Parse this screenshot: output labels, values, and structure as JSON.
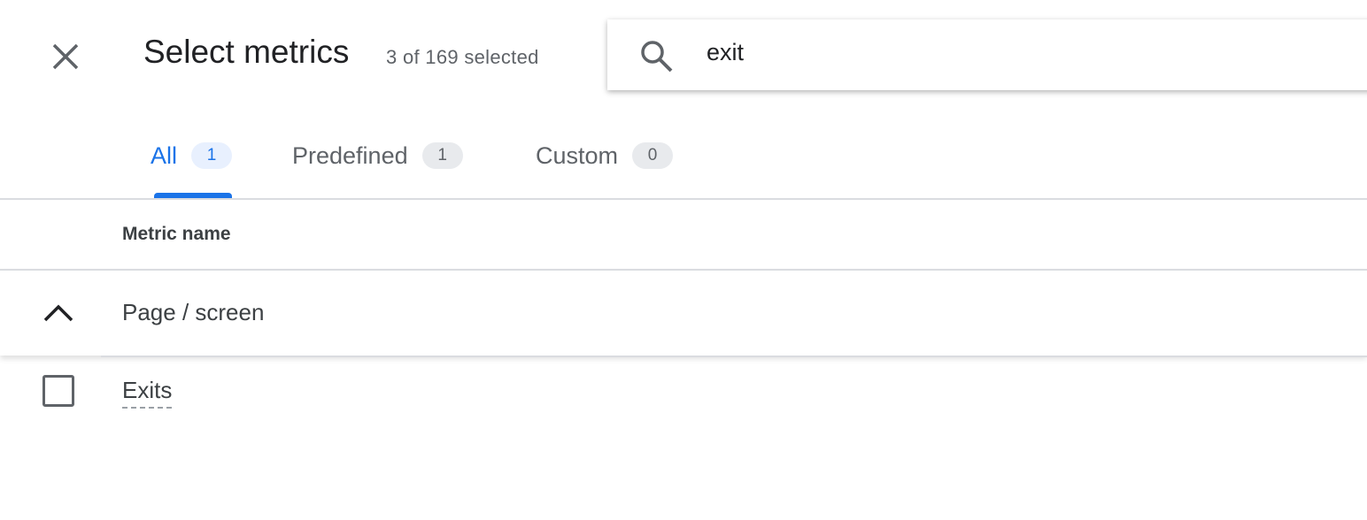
{
  "header": {
    "title": "Select metrics",
    "subtitle": "3 of 169 selected",
    "close_icon": "close-icon"
  },
  "search": {
    "value": "exit",
    "icon": "search-icon"
  },
  "tabs": [
    {
      "label": "All",
      "count": "1",
      "active": true
    },
    {
      "label": "Predefined",
      "count": "1",
      "active": false
    },
    {
      "label": "Custom",
      "count": "0",
      "active": false
    }
  ],
  "table": {
    "column_header": "Metric name",
    "groups": [
      {
        "label": "Page / screen",
        "expanded": true,
        "items": [
          {
            "label": "Exits",
            "checked": false
          }
        ]
      }
    ]
  },
  "colors": {
    "accent": "#1a73e8"
  }
}
